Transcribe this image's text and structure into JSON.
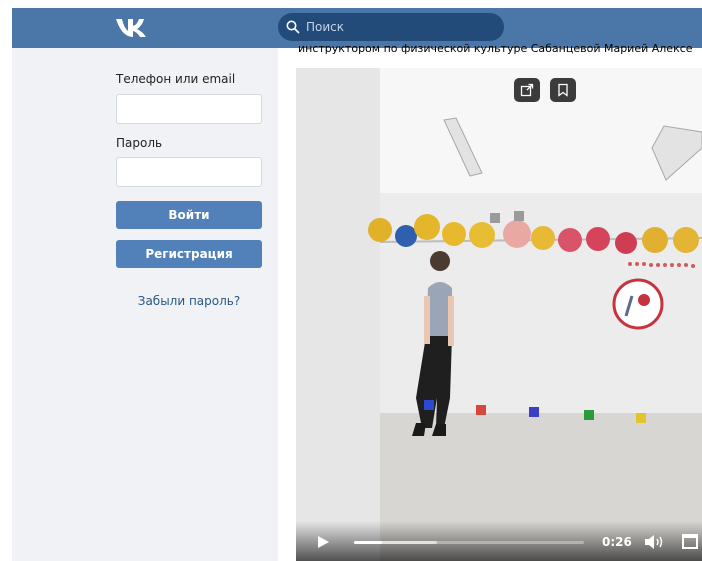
{
  "header": {
    "logo_icon": "vk-logo-icon",
    "search_placeholder": "Поиск",
    "brand_color": "#4a76a8"
  },
  "login": {
    "phone_label": "Телефон или email",
    "password_label": "Пароль",
    "login_button": "Войти",
    "register_button": "Регистрация",
    "forgot_link": "Забыли пароль?"
  },
  "post": {
    "description": "инструктором по физической культуре Сабанцевой Марией Алексе"
  },
  "video": {
    "share_icon": "share-icon",
    "bookmark_icon": "bookmark-icon",
    "current_time": "0:26",
    "progress_fraction": 0.12,
    "buffered_fraction": 0.36,
    "play_icon": "play-icon",
    "volume_icon": "volume-icon",
    "fullscreen_icon": "fullscreen-icon"
  }
}
